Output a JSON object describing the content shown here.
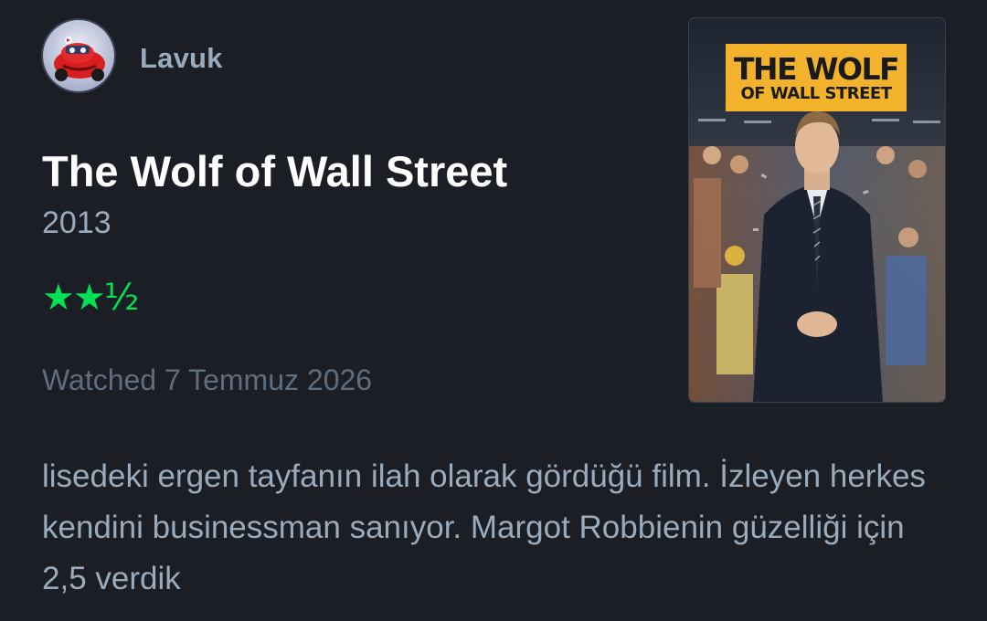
{
  "user": {
    "name": "Lavuk"
  },
  "film": {
    "title": "The Wolf of Wall Street",
    "year": "2013",
    "rating": "★★½",
    "watched": "Watched 7 Temmuz 2026"
  },
  "review": {
    "text": "lisedeki ergen tayfanın ilah olarak gördüğü film. İzleyen herkes kendini businessman sanıyor. Margot Robbienin güzelliği için 2,5 verdik"
  },
  "poster": {
    "title_line1": "THE WOLF",
    "title_line2": "OF WALL STREET"
  },
  "colors": {
    "background": "#1b1e24",
    "accent_green": "#00e054",
    "muted_text": "#9aabbd",
    "dim_text": "#5f6d7e",
    "poster_banner": "#f2b22b"
  }
}
